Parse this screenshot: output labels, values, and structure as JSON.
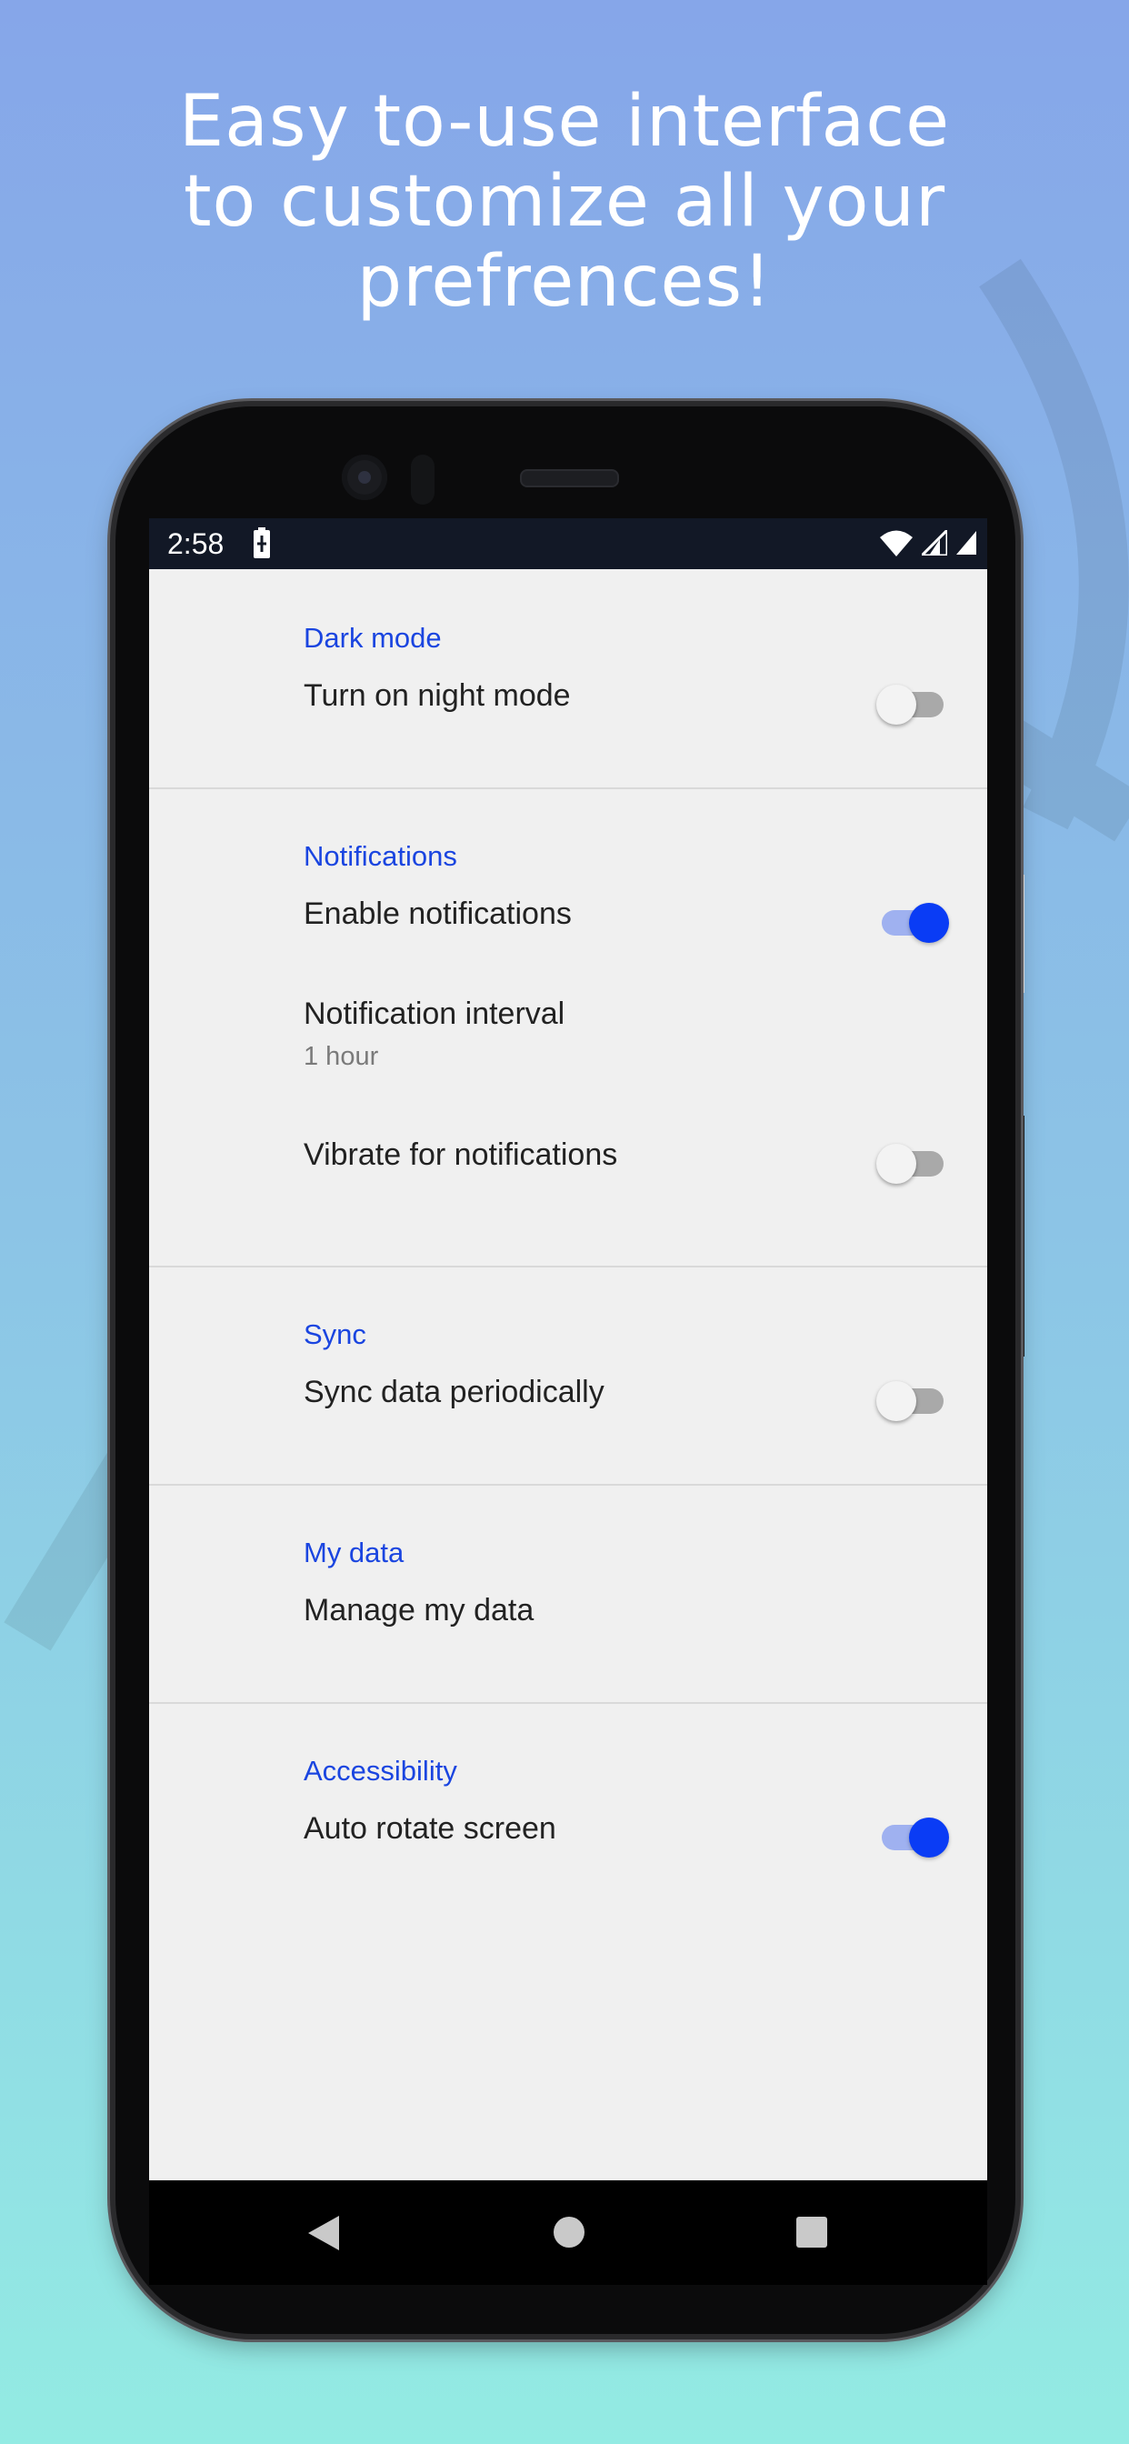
{
  "headline": {
    "line1": "Easy to-use interface",
    "line2": "to customize all your",
    "line3": "prefrences!"
  },
  "status_bar": {
    "time": "2:58",
    "icons": [
      "battery-charging-icon",
      "wifi-icon",
      "cell-signal-icon",
      "network-icon"
    ]
  },
  "settings": {
    "dark_mode": {
      "title": "Dark mode",
      "night_mode": {
        "label": "Turn on night mode",
        "enabled": false
      }
    },
    "notifications": {
      "title": "Notifications",
      "enable": {
        "label": "Enable notifications",
        "enabled": true
      },
      "interval": {
        "label": "Notification interval",
        "summary": "1 hour"
      },
      "vibrate": {
        "label": "Vibrate for notifications",
        "enabled": false
      }
    },
    "sync": {
      "title": "Sync",
      "periodic": {
        "label": "Sync data periodically",
        "enabled": false
      }
    },
    "my_data": {
      "title": "My data",
      "manage": {
        "label": "Manage my data"
      }
    },
    "accessibility": {
      "title": "Accessibility",
      "auto_rotate": {
        "label": "Auto rotate screen",
        "enabled": true
      }
    }
  },
  "nav_bar": {
    "icons": [
      "back-icon",
      "home-icon",
      "recents-icon"
    ]
  },
  "colors": {
    "accent": "#0a3cf5",
    "section_title": "#1a45e0",
    "background_top": "#86a6e9",
    "background_bottom": "#93ebe3"
  }
}
